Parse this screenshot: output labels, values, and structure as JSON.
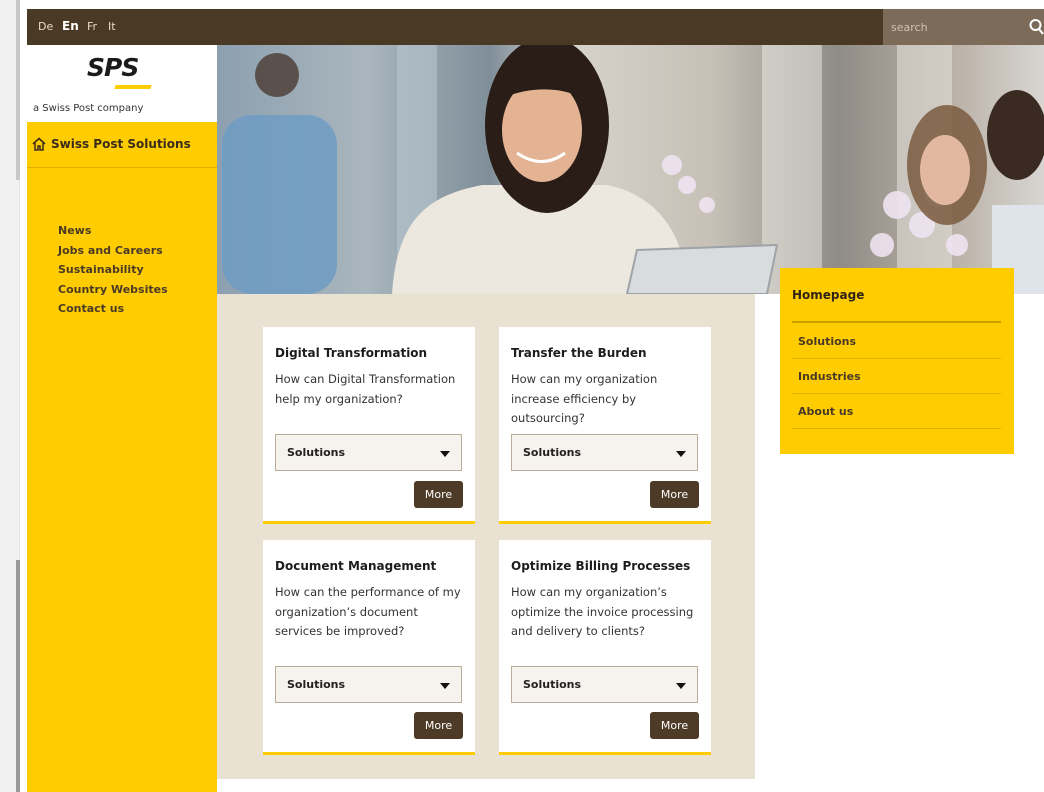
{
  "topbar": {
    "languages": [
      "De",
      "En",
      "Fr",
      "It"
    ],
    "active_language": "En",
    "search_placeholder": "search"
  },
  "sidebar": {
    "logo": "SPS",
    "tagline": "a Swiss Post company",
    "home_label": "Swiss Post Solutions",
    "nav": [
      "News",
      "Jobs and Careers",
      "Sustainability",
      "Country Websites",
      "Contact us"
    ]
  },
  "cards": [
    {
      "title": "Digital Transformation",
      "text": "How can Digital Transformation help my organization?",
      "select_value": "Solutions",
      "button": "More"
    },
    {
      "title": "Transfer the Burden",
      "text": "How can my organization increase efficiency by outsourcing?",
      "select_value": "Solutions",
      "button": "More"
    },
    {
      "title": "Document Management",
      "text": "How can the performance of my organization’s document services be improved?",
      "select_value": "Solutions",
      "button": "More"
    },
    {
      "title": "Optimize Billing Processes",
      "text": "How can my organization’s optimize the invoice processing and delivery to clients?",
      "select_value": "Solutions",
      "button": "More"
    }
  ],
  "rightnav": {
    "title": "Homepage",
    "items": [
      "Solutions",
      "Industries",
      "About us"
    ]
  },
  "colors": {
    "brand_yellow": "#ffcc00",
    "dark_brown": "#4a3a25",
    "card_background": "#e9e1d2"
  }
}
